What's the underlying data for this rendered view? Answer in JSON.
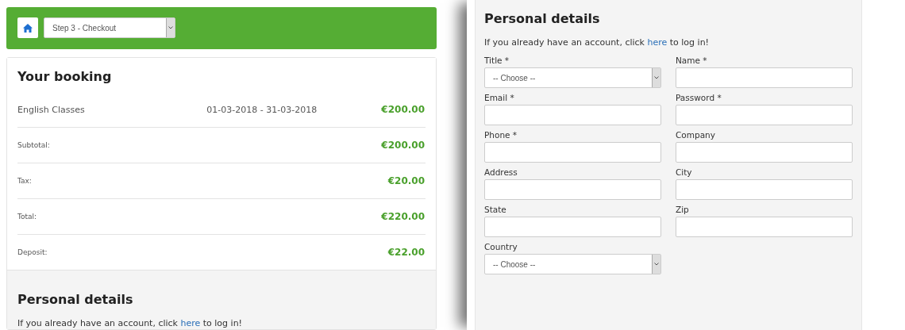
{
  "left": {
    "header": {
      "step_select": {
        "value": "Step 3 - Checkout"
      }
    },
    "booking": {
      "title": "Your booking",
      "item": {
        "name": "English Classes",
        "dates": "01-03-2018 - 31-03-2018",
        "price": "€200.00"
      },
      "summary": [
        {
          "label": "Subtotal:",
          "value": "€200.00"
        },
        {
          "label": "Tax:",
          "value": "€20.00"
        },
        {
          "label": "Total:",
          "value": "€220.00"
        },
        {
          "label": "Deposit:",
          "value": "€22.00"
        }
      ]
    },
    "personal": {
      "title": "Personal details",
      "login_text": {
        "before": "If you already have an account, click ",
        "link": "here",
        "after": " to log in!"
      }
    }
  },
  "right": {
    "title": "Personal details",
    "login_text": {
      "before": "If you already have an account, click ",
      "link": "here",
      "after": " to log in!"
    },
    "fields": [
      {
        "label": "Title *",
        "kind": "select",
        "value": "-- Choose --"
      },
      {
        "label": "Name *",
        "kind": "text"
      },
      {
        "label": "Email *",
        "kind": "text"
      },
      {
        "label": "Password *",
        "kind": "text"
      },
      {
        "label": "Phone *",
        "kind": "text"
      },
      {
        "label": "Company",
        "kind": "text"
      },
      {
        "label": "Address",
        "kind": "text"
      },
      {
        "label": "City",
        "kind": "text"
      },
      {
        "label": "State",
        "kind": "text"
      },
      {
        "label": "Zip",
        "kind": "text"
      },
      {
        "label": "Country",
        "kind": "select",
        "value": "-- Choose --"
      }
    ]
  }
}
